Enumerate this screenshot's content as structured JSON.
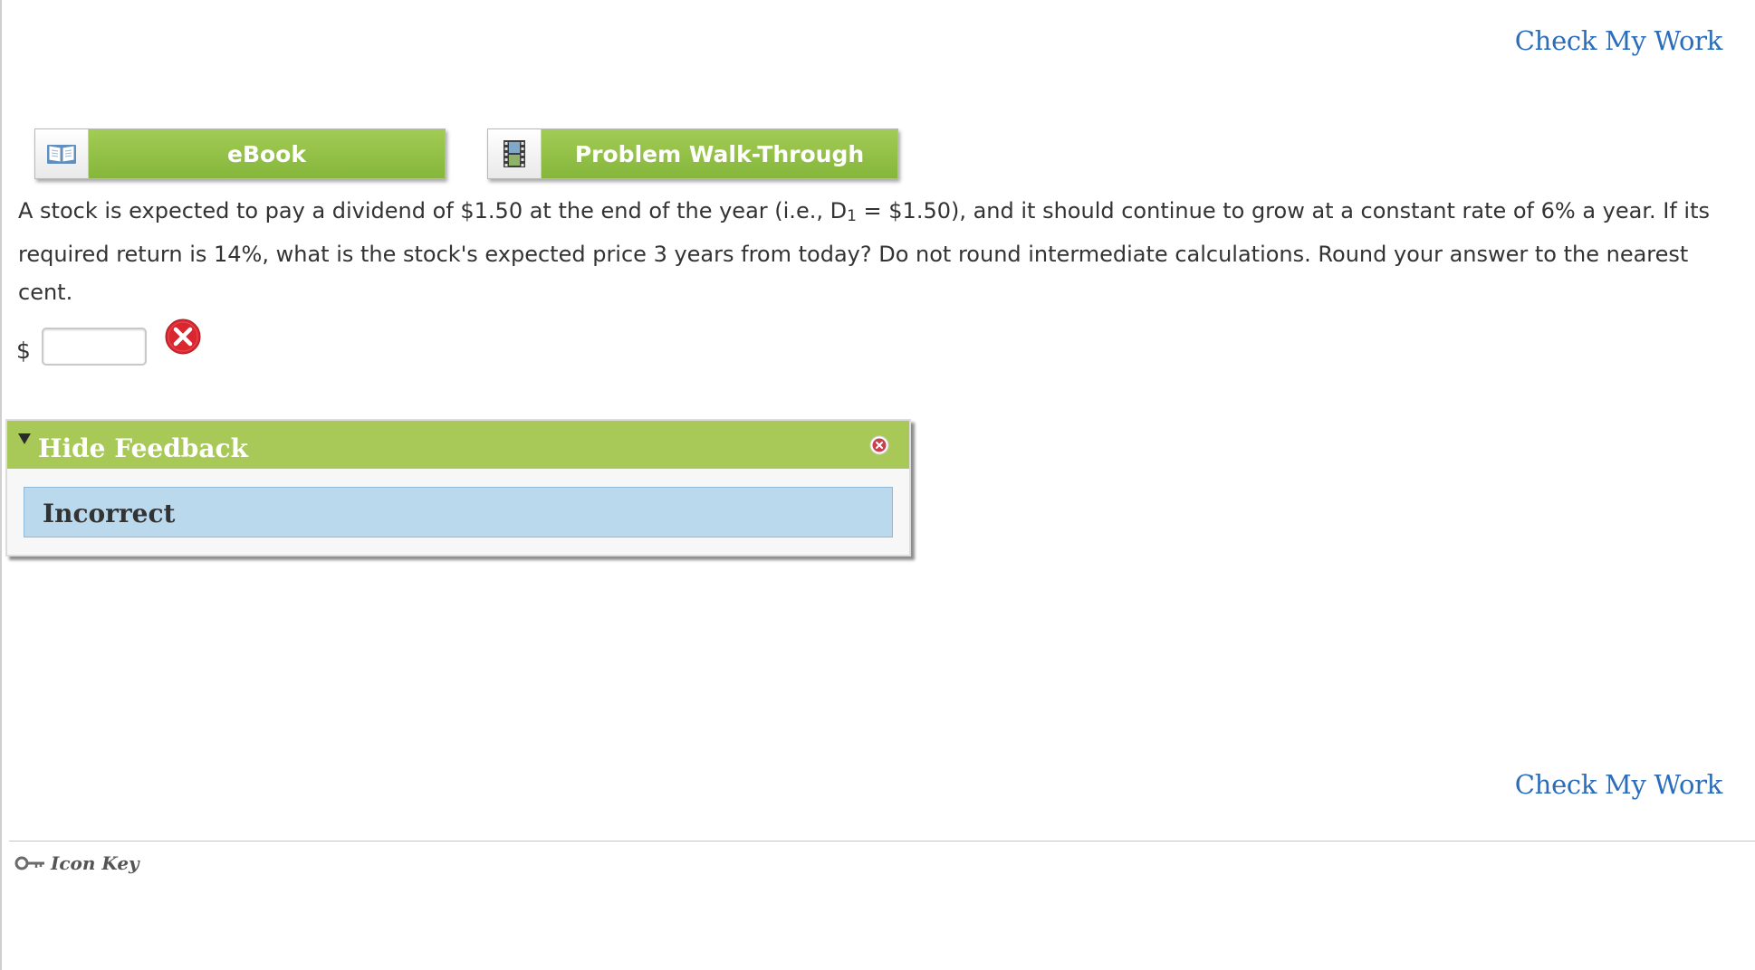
{
  "header": {
    "check_work_label": "Check My Work"
  },
  "resources": {
    "ebook_label": "eBook",
    "walkthrough_label": "Problem Walk-Through"
  },
  "question": {
    "part1": "A stock is expected to pay a dividend of $1.50 at the end of the year (i.e., D",
    "subscript": "1",
    "part2": " = $1.50), and it should continue to grow at a constant rate of 6% a year. If its required return is 14%, what is the stock's expected price 3 years from today? Do not round intermediate calculations. Round your answer to the nearest cent."
  },
  "answer": {
    "currency_symbol": "$",
    "value": "",
    "status": "incorrect"
  },
  "feedback": {
    "toggle_label": "Hide Feedback",
    "result": "Incorrect"
  },
  "footer": {
    "check_work_label": "Check My Work",
    "icon_key_label": "Icon Key"
  },
  "icons": {
    "ebook": "book-icon",
    "walkthrough": "film-icon",
    "incorrect": "incorrect-x-icon",
    "close": "close-icon",
    "icon_key": "key-icon"
  },
  "colors": {
    "link": "#2a6ebb",
    "button_green": "#8cbd3d",
    "feedback_header": "#a8c957",
    "feedback_body": "#bbd9ec",
    "incorrect_red": "#d9262f"
  }
}
